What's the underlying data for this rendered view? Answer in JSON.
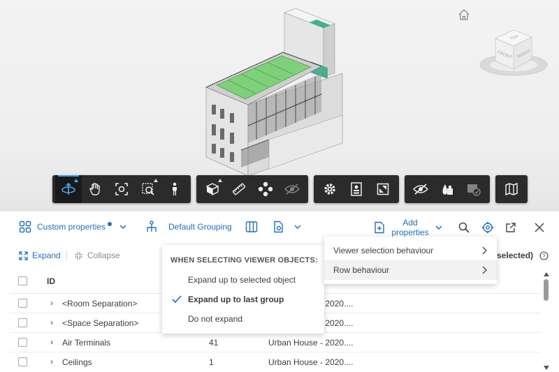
{
  "viewer": {
    "home_icon": "home-icon",
    "viewcube_faces": {
      "top": "TOP",
      "front": "FRONT",
      "right": "RIGHT"
    },
    "toolbar_groups": [
      [
        "orbit-icon",
        "pan-icon",
        "fit-to-view-icon",
        "zoom-window-icon",
        "first-person-icon"
      ],
      [
        "section-box-icon",
        "measure-icon",
        "model-browser-icon",
        "ghosting-icon"
      ],
      [
        "settings-icon",
        "properties-icon",
        "fullscreen-icon"
      ],
      [
        "hide-icon",
        "isolate-icon",
        "show-all-icon"
      ],
      [
        "map-icon"
      ]
    ]
  },
  "panel": {
    "header": {
      "custom_properties": "Custom properties",
      "default_grouping": "Default Grouping",
      "add_properties": "Add properties"
    },
    "actions": {
      "expand": "Expand",
      "collapse": "Collapse",
      "selected_text": "0 selected)"
    },
    "table": {
      "columns": [
        "ID"
      ],
      "rows": [
        {
          "id": "<Room Separation>",
          "count": "",
          "file": "Urban House - 2020...."
        },
        {
          "id": "<Space Separation>",
          "count": "",
          "file": "Urban House - 2020...."
        },
        {
          "id": "Air Terminals",
          "count": "41",
          "file": "Urban House - 2020...."
        },
        {
          "id": "Ceilings",
          "count": "1",
          "file": "Urban House - 2020...."
        }
      ]
    }
  },
  "expand_menu": {
    "heading": "WHEN SELECTING VIEWER OBJECTS:",
    "options": [
      {
        "label": "Expand up to selected object",
        "checked": false
      },
      {
        "label": "Expand up to last group",
        "checked": true
      },
      {
        "label": "Do not expand",
        "checked": false
      }
    ]
  },
  "settings_menu": {
    "items": [
      {
        "label": "Viewer selection behaviour"
      },
      {
        "label": "Row behaviour"
      }
    ]
  },
  "colors": {
    "accent": "#1f6fbf",
    "toolbar_bg": "#2b2b2b",
    "active_blue": "#3aa0f0",
    "roof_green": "#7fd07a"
  }
}
